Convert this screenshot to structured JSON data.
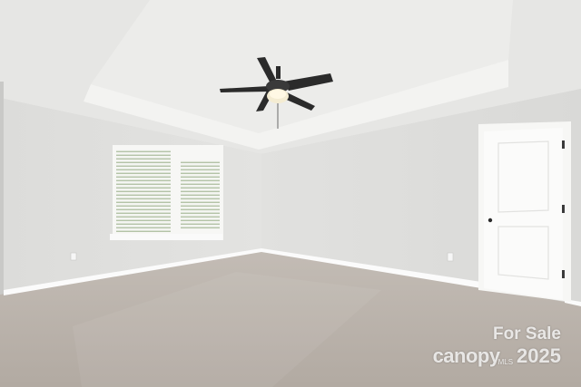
{
  "photo": {
    "description_colors": {
      "wall": "#e3e3e1",
      "ceiling": "#e8e8e6",
      "carpet": "#bdb5ad",
      "trim": "#ffffff",
      "fan": "#2b2b2b"
    }
  },
  "watermark": {
    "line1": "For Sale",
    "brand": "canopy",
    "brand_suffix": "MLS",
    "year": "2025"
  }
}
